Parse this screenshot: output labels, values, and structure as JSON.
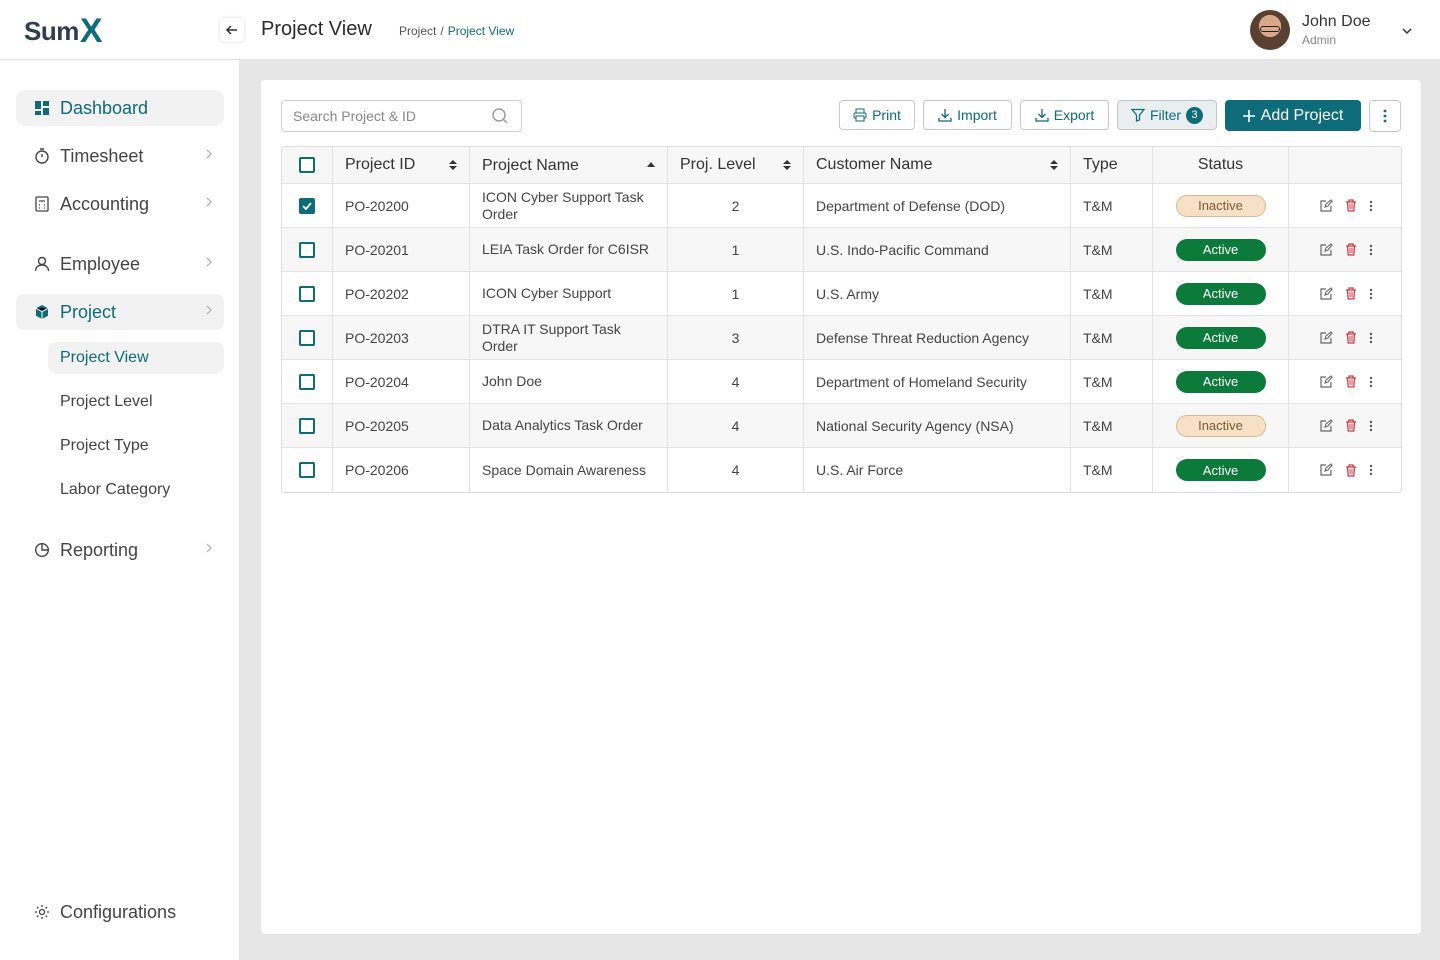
{
  "header": {
    "logo_main": "Sum",
    "logo_x": "X",
    "title": "Project View",
    "breadcrumb": [
      "Project",
      "/",
      "Project View"
    ],
    "user": {
      "name": "John Doe",
      "role": "Admin"
    }
  },
  "sidebar": {
    "items": [
      {
        "label": "Dashboard",
        "icon": "grid-icon"
      },
      {
        "label": "Timesheet",
        "icon": "stopwatch-icon"
      },
      {
        "label": "Accounting",
        "icon": "calculator-icon"
      },
      {
        "label": "Employee",
        "icon": "user-icon"
      },
      {
        "label": "Project",
        "icon": "cube-icon"
      },
      {
        "label": "Reporting",
        "icon": "pie-chart-icon"
      }
    ],
    "project_sub": [
      "Project View",
      "Project Level",
      "Project Type",
      "Labor Category"
    ],
    "configurations": "Configurations"
  },
  "toolbar": {
    "search_placeholder": "Search Project & ID",
    "print": "Print",
    "import": "Import",
    "export": "Export",
    "filter": "Filter",
    "filter_count": "3",
    "add": "Add Project"
  },
  "table": {
    "columns": [
      "Project ID",
      "Project Name",
      "Proj. Level",
      "Customer Name",
      "Type",
      "Status"
    ],
    "rows": [
      {
        "id": "PO-20200",
        "name": "ICON Cyber Support Task Order",
        "level": "2",
        "customer": "Department of Defense (DOD)",
        "type": "T&M",
        "status": "Inactive",
        "checked": true
      },
      {
        "id": "PO-20201",
        "name": "LEIA Task Order for C6ISR",
        "level": "1",
        "customer": "U.S. Indo-Pacific Command",
        "type": "T&M",
        "status": "Active",
        "checked": false
      },
      {
        "id": "PO-20202",
        "name": "ICON Cyber Support",
        "level": "1",
        "customer": "U.S. Army",
        "type": "T&M",
        "status": "Active",
        "checked": false
      },
      {
        "id": "PO-20203",
        "name": "DTRA IT Support Task Order",
        "level": "3",
        "customer": "Defense Threat Reduction Agency",
        "type": "T&M",
        "status": "Active",
        "checked": false
      },
      {
        "id": "PO-20204",
        "name": "John Doe",
        "level": "4",
        "customer": "Department of Homeland Security",
        "type": "T&M",
        "status": "Active",
        "checked": false
      },
      {
        "id": "PO-20205",
        "name": "Data Analytics Task Order",
        "level": "4",
        "customer": "National Security Agency (NSA)",
        "type": "T&M",
        "status": "Inactive",
        "checked": false
      },
      {
        "id": "PO-20206",
        "name": "Space Domain Awareness",
        "level": "4",
        "customer": "U.S. Air Force",
        "type": "T&M",
        "status": "Active",
        "checked": false
      }
    ]
  },
  "colors": {
    "accent": "#0d6b7a",
    "active": "#0b7a3a",
    "inactive_bg": "#f6e1c7",
    "delete": "#d9363e"
  }
}
